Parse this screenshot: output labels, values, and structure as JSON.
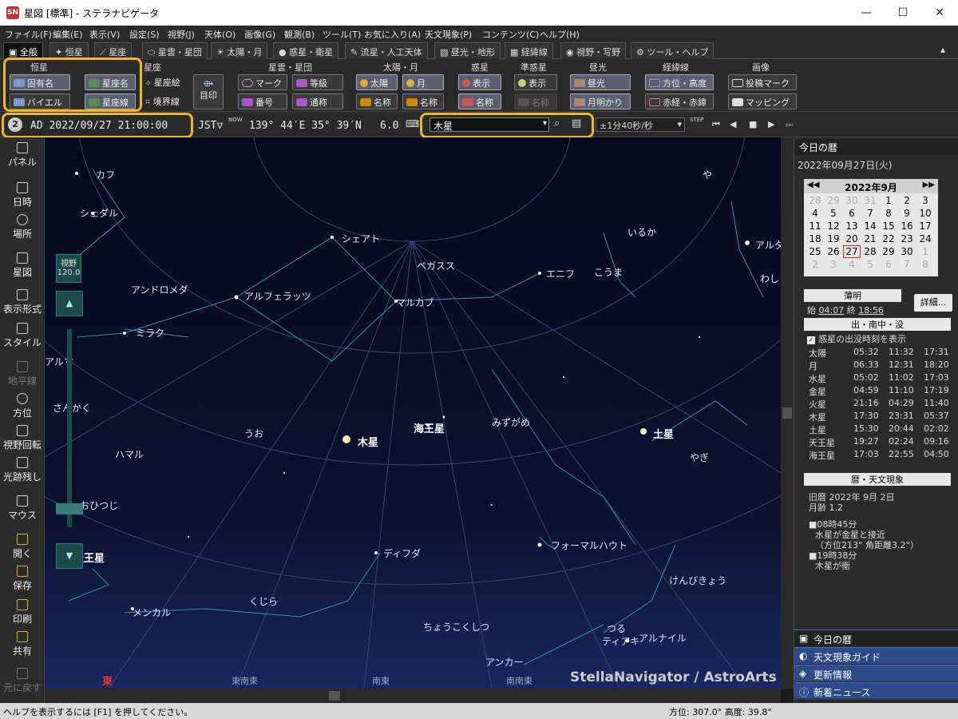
{
  "window": {
    "title": "星図 [標準] - ステラナビゲータ",
    "min": "—",
    "max": "☐",
    "close": "✕"
  },
  "menu": [
    "ファイル(F)",
    "編集(E)",
    "表示(V)",
    "設定(S)",
    "視野(J)",
    "天体(O)",
    "画像(G)",
    "観測(B)",
    "ツール(T)",
    "お気に入り(A)",
    "天文現象(P)",
    "コンテンツ(C)",
    "ヘルプ(H)"
  ],
  "tabs": [
    "全般",
    "恒星",
    "星座",
    "星雲・星団",
    "太陽・月",
    "惑星・衛星",
    "流星・人工天体",
    "昼光・地形",
    "経緯線",
    "視野・写野",
    "ツール・ヘルプ"
  ],
  "ribbon": {
    "groups": [
      "恒星",
      "星座",
      "星雲・星団",
      "太陽・月",
      "惑星",
      "準惑星",
      "昼光",
      "経緯線",
      "画像"
    ],
    "buttons": {
      "koyumei": "固有名",
      "bayer": "バイエル",
      "seizamei": "星座名",
      "seizasen": "星座線",
      "seizae": "星座絵",
      "kyokaisen": "境界線",
      "mejirushi": "目印",
      "mark": "マーク",
      "tokyu": "等級",
      "bango": "番号",
      "tsusho": "通称",
      "taiyo": "太陽",
      "tsuki": "月",
      "meisho1": "名称",
      "meisho2": "名称",
      "hyoji1": "表示",
      "meisho3": "名称",
      "hyoji2": "表示",
      "meisho4": "名称",
      "chuko": "昼光",
      "gemmeikari": "月明かり",
      "hoi": "方位・高度",
      "sekkei": "赤経・赤緯",
      "toko": "投稿マーク",
      "mapping": "マッピング"
    }
  },
  "toolbar": {
    "num": "2",
    "datetime": "AD 2022/09/27 21:00:00",
    "tz": "JST▽",
    "now": "NOW",
    "location": "139° 44′E 35° 39′N",
    "limit": "6.0",
    "search_value": "木星",
    "step": "±1分40秒/秒",
    "step_label": "STEP"
  },
  "left_panel": [
    "パネル",
    "日時",
    "場所",
    "星図",
    "表示形式",
    "スタイル",
    "地平線",
    "方位",
    "視野回転",
    "光跡残し",
    "マウス",
    "開く",
    "保存",
    "印刷",
    "共有",
    "元に戻す"
  ],
  "fov": {
    "label": "視野",
    "value": "120.0"
  },
  "sky": {
    "labels": [
      "カフ",
      "シェダル",
      "シェアト",
      "ペガスス",
      "エニフ",
      "こうま",
      "いるか",
      "アルタ",
      "わし",
      "アンドロメダ",
      "アルフェラッツ",
      "マルカブ",
      "ミラク",
      "アルマ",
      "さんかく",
      "うお",
      "木星",
      "海王星",
      "みずがめ",
      "土星",
      "やぎ",
      "ハマル",
      "おひつじ",
      "天王星",
      "ディフダ",
      "フォーマルハウト",
      "けんびきょう",
      "くじら",
      "メンカル",
      "ちょうこくしつ",
      "つる",
      "ティアキ",
      "アルナイル",
      "アンカー",
      "や"
    ],
    "directions": [
      "東",
      "東南東",
      "南東",
      "南南東"
    ],
    "credit": "StellaNavigator / AstroArts"
  },
  "almanac": {
    "header": "今日の暦",
    "date": "2022年09月27日(火)",
    "month": "2022年9月",
    "weeks": [
      [
        "28",
        "29",
        "30",
        "31",
        "1",
        "2",
        "3"
      ],
      [
        "4",
        "5",
        "6",
        "7",
        "8",
        "9",
        "10"
      ],
      [
        "11",
        "12",
        "13",
        "14",
        "15",
        "16",
        "17"
      ],
      [
        "18",
        "19",
        "20",
        "21",
        "22",
        "23",
        "24"
      ],
      [
        "25",
        "26",
        "27",
        "28",
        "29",
        "30",
        "1"
      ],
      [
        "2",
        "3",
        "4",
        "5",
        "6",
        "7",
        "8"
      ]
    ],
    "twilight": "薄明",
    "start_label": "始",
    "start": "04:07",
    "end_label": "終",
    "end": "18:56",
    "detail": "詳細...",
    "rise_header": "出・南中・没",
    "planet_check": "惑星の出没時刻を表示",
    "rise": [
      [
        "太陽",
        "05:32",
        "11:32",
        "17:31"
      ],
      [
        "月",
        "06:33",
        "12:31",
        "18:20"
      ],
      [
        "水星",
        "05:02",
        "11:02",
        "17:03"
      ],
      [
        "金星",
        "04:59",
        "11:10",
        "17:19"
      ],
      [
        "火星",
        "21:16",
        "04:29",
        "11:40"
      ],
      [
        "木星",
        "17:30",
        "23:31",
        "05:37"
      ],
      [
        "土星",
        "15:30",
        "20:44",
        "02:02"
      ],
      [
        "天王星",
        "19:27",
        "02:24",
        "09:16"
      ],
      [
        "海王星",
        "17:03",
        "22:55",
        "04:50"
      ]
    ],
    "event_header": "暦・天文現象",
    "lunar": "旧暦 2022年 9月 2日",
    "age": "月齢 1.2",
    "events": [
      "■08時45分",
      "水星が金星と接近",
      "（方位213° 角距離3.2°）",
      "■19時38分",
      "木星が衝"
    ]
  },
  "bottom_buttons": [
    "今日の暦",
    "天文現象ガイド",
    "更新情報",
    "新着ニュース"
  ],
  "status": {
    "help": "ヘルプを表示するには [F1] を押してください。",
    "azimuth": "方位: 307.0° 高度: 39.8°"
  }
}
